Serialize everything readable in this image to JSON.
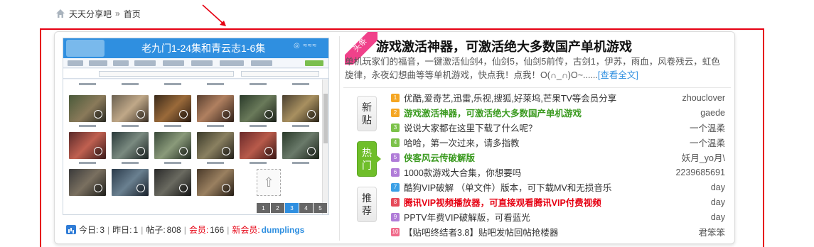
{
  "breadcrumb": {
    "site": "天天分享吧",
    "separator": "»",
    "current": "首页"
  },
  "slider": {
    "image_caption": "老九门1-24集和青云志1-6集",
    "pages": [
      "1",
      "2",
      "3",
      "4",
      "5"
    ],
    "active_page": 3
  },
  "stats": {
    "today_label": "今日:",
    "today_value": "3",
    "yesterday_label": "昨日:",
    "yesterday_value": "1",
    "posts_label": "帖子:",
    "posts_value": "808",
    "members_label": "会员:",
    "members_value": "166",
    "newest_label": "新会员:",
    "newest_value": "dumplings",
    "separator": "|"
  },
  "headline": {
    "badge": "头条",
    "title": "游戏激活神器，可激活绝大多数国产单机游戏",
    "summary": "单机玩家们的福音，一键激活仙剑4，仙剑5，仙剑5前传，古剑1，伊苏，雨血，风卷残云，虹色旋律，永夜幻想曲等等单机游戏，快点我！点我！O(∩_∩)O~......",
    "read_more": "[查看全文]"
  },
  "tabs": [
    {
      "line1": "新",
      "line2": "贴"
    },
    {
      "line1": "热",
      "line2": "门"
    },
    {
      "line1": "推",
      "line2": "荐"
    }
  ],
  "colors": {
    "accent": "#2f8fe0",
    "hot": "#6fbe2a",
    "alert": "#e60012",
    "ribbon": "#f0418a"
  },
  "threads": [
    {
      "n": "1",
      "color": "#f5a623",
      "title": "优酷,爱奇艺,迅雷,乐视,搜狐,好莱坞,芒果TV等会员分享",
      "style": "",
      "author": "zhouclover"
    },
    {
      "n": "2",
      "color": "#f5a623",
      "title": "游戏激活神器，可激活绝大多数国产单机游戏",
      "style": "green",
      "author": "gaede"
    },
    {
      "n": "3",
      "color": "#7cc24a",
      "title": "说说大家都在这里下载了什么呢？",
      "style": "",
      "author": "一个温柔"
    },
    {
      "n": "4",
      "color": "#7cc24a",
      "title": "哈哈，第一次过来，请多指教",
      "style": "",
      "author": "一个温柔"
    },
    {
      "n": "5",
      "color": "#b07cd8",
      "title": "侠客风云传破解版",
      "style": "green",
      "author": "妖月_yo月\\"
    },
    {
      "n": "6",
      "color": "#b07cd8",
      "title": "1000款游戏大合集，你想要吗",
      "style": "",
      "author": "2239685691"
    },
    {
      "n": "7",
      "color": "#3ba0e6",
      "title": "酷狗VIP破解 （单文件）版本，可下载MV和无损音乐",
      "style": "",
      "author": "day"
    },
    {
      "n": "8",
      "color": "#e64a5a",
      "title": "腾讯VIP视频播放器，可直接观看腾讯VIP付费视频",
      "style": "red",
      "author": "day"
    },
    {
      "n": "9",
      "color": "#b07cd8",
      "title": "PPTV年费VIP破解版，可看蓝光",
      "style": "",
      "author": "day"
    },
    {
      "n": "10",
      "color": "#f06a8a",
      "title": "【贴吧终结者3.8】贴吧发帖回帖抢楼器",
      "style": "",
      "author": "君笨笨"
    }
  ]
}
